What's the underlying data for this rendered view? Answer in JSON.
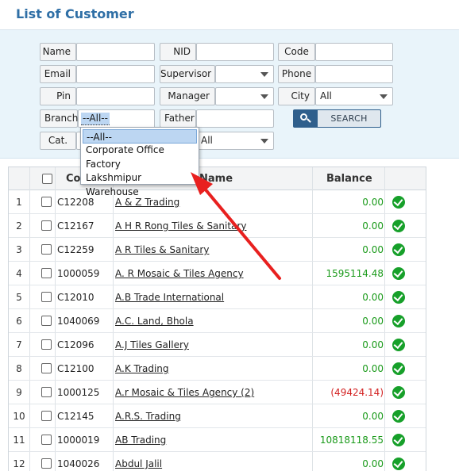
{
  "page": {
    "title": "List of Customer"
  },
  "filters": {
    "name_label": "Name",
    "nid_label": "NID",
    "code_label": "Code",
    "email_label": "Email",
    "supervisor_label": "Supervisor",
    "phone_label": "Phone",
    "pin_label": "Pin",
    "manager_label": "Manager",
    "city_label": "City",
    "city_value": "All",
    "branch_label": "Branch",
    "branch_value": "--All--",
    "father_label": "Father",
    "cat_label": "Cat.",
    "cat_value": "All",
    "search_label": "SEARCH"
  },
  "branch_dropdown": {
    "options": [
      "--All--",
      "Corporate Office",
      "Factory",
      "Lakshmipur Warehouse"
    ],
    "selected_index": 0
  },
  "table": {
    "headers": {
      "code": "Co",
      "name": "Name",
      "balance": "Balance"
    },
    "rows": [
      {
        "n": "1",
        "code": "C12208",
        "name": "A & Z Trading",
        "balance": "0.00",
        "negative": false
      },
      {
        "n": "2",
        "code": "C12167",
        "name": "A H R Rong Tiles & Sanitary",
        "balance": "0.00",
        "negative": false
      },
      {
        "n": "3",
        "code": "C12259",
        "name": "A R Tiles & Sanitary",
        "balance": "0.00",
        "negative": false
      },
      {
        "n": "4",
        "code": "1000059",
        "name": "A. R Mosaic & Tiles Agency",
        "balance": "1595114.48",
        "negative": false
      },
      {
        "n": "5",
        "code": "C12010",
        "name": "A.B Trade International",
        "balance": "0.00",
        "negative": false
      },
      {
        "n": "6",
        "code": "1040069",
        "name": "A.C. Land, Bhola",
        "balance": "0.00",
        "negative": false
      },
      {
        "n": "7",
        "code": "C12096",
        "name": "A.J Tiles Gallery",
        "balance": "0.00",
        "negative": false
      },
      {
        "n": "8",
        "code": "C12100",
        "name": "A.K Trading",
        "balance": "0.00",
        "negative": false
      },
      {
        "n": "9",
        "code": "1000125",
        "name": "A.r Mosaic & Tiles Agency (2)",
        "balance": "(49424.14)",
        "negative": true
      },
      {
        "n": "10",
        "code": "C12145",
        "name": "A.R.S. Trading",
        "balance": "0.00",
        "negative": false
      },
      {
        "n": "11",
        "code": "1000019",
        "name": "AB Trading",
        "balance": "10818118.55",
        "negative": false
      },
      {
        "n": "12",
        "code": "1040026",
        "name": "Abdul Jalil",
        "balance": "0.00",
        "negative": false
      }
    ]
  },
  "colors": {
    "accent": "#2f6fa6",
    "positive": "#1a9a1a",
    "negative": "#d22020",
    "annotation_arrow": "#e8201f"
  }
}
